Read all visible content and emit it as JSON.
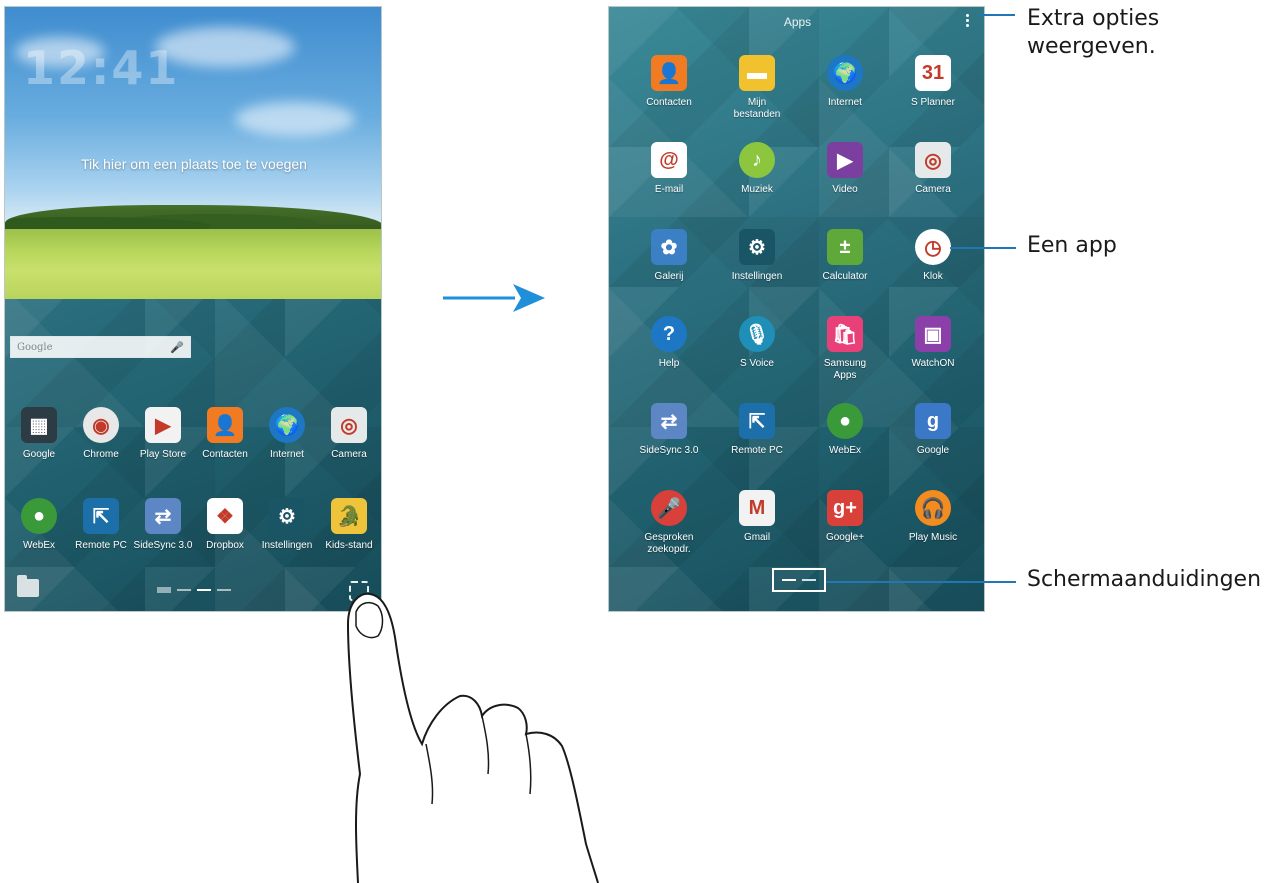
{
  "home": {
    "clock": "12:41",
    "clock_sub": "",
    "add_place": "Tik hier om een plaats toe te voegen",
    "search_label": "Google",
    "apps": [
      {
        "label": "Google",
        "icon": "google-folder-icon",
        "color": "#2d3b45"
      },
      {
        "label": "Chrome",
        "icon": "chrome-icon",
        "color": "#e8e8e8"
      },
      {
        "label": "Play Store",
        "icon": "play-store-icon",
        "color": "#f2f2f2"
      },
      {
        "label": "Contacten",
        "icon": "contacts-icon",
        "color": "#f07b22"
      },
      {
        "label": "Internet",
        "icon": "globe-icon",
        "color": "#1d77c4"
      },
      {
        "label": "Camera",
        "icon": "camera-icon",
        "color": "#e6e9ea"
      },
      {
        "label": "WebEx",
        "icon": "webex-icon",
        "color": "#3a9a3a"
      },
      {
        "label": "Remote PC",
        "icon": "remote-pc-icon",
        "color": "#1c6fa8"
      },
      {
        "label": "SideSync 3.0",
        "icon": "sidesync-icon",
        "color": "#5d86c5"
      },
      {
        "label": "Dropbox",
        "icon": "dropbox-icon",
        "color": "#ffffff"
      },
      {
        "label": "Instellingen",
        "icon": "settings-gear-icon",
        "color": "#1a5566"
      },
      {
        "label": "Kids-stand",
        "icon": "kids-mode-icon",
        "color": "#f0c43a"
      }
    ]
  },
  "apps_screen": {
    "title": "Apps",
    "apps": [
      {
        "label": "Contacten",
        "icon": "contacts-icon",
        "color": "#f07b22"
      },
      {
        "label": "Mijn bestanden",
        "icon": "folder-icon",
        "color": "#f2c12e"
      },
      {
        "label": "Internet",
        "icon": "globe-icon",
        "color": "#1d77c4"
      },
      {
        "label": "S Planner",
        "icon": "calendar-icon",
        "color": "#ffffff"
      },
      {
        "label": "E-mail",
        "icon": "email-icon",
        "color": "#ffffff"
      },
      {
        "label": "Muziek",
        "icon": "music-icon",
        "color": "#8cc63f"
      },
      {
        "label": "Video",
        "icon": "video-icon",
        "color": "#7b3fa0"
      },
      {
        "label": "Camera",
        "icon": "camera-icon",
        "color": "#e6e9ea"
      },
      {
        "label": "Galerij",
        "icon": "gallery-icon",
        "color": "#3b7fc4"
      },
      {
        "label": "Instellingen",
        "icon": "settings-gear-icon",
        "color": "#1a5566"
      },
      {
        "label": "Calculator",
        "icon": "calculator-icon",
        "color": "#5fa83a"
      },
      {
        "label": "Klok",
        "icon": "clock-icon",
        "color": "#ffffff"
      },
      {
        "label": "Help",
        "icon": "help-icon",
        "color": "#1d77c4"
      },
      {
        "label": "S Voice",
        "icon": "microphone-icon",
        "color": "#1f8fb8"
      },
      {
        "label": "Samsung Apps",
        "icon": "samsung-apps-icon",
        "color": "#e8417a"
      },
      {
        "label": "WatchON",
        "icon": "watchon-icon",
        "color": "#8b3fa8"
      },
      {
        "label": "SideSync 3.0",
        "icon": "sidesync-icon",
        "color": "#5d86c5"
      },
      {
        "label": "Remote PC",
        "icon": "remote-pc-icon",
        "color": "#1c6fa8"
      },
      {
        "label": "WebEx",
        "icon": "webex-icon",
        "color": "#3a9a3a"
      },
      {
        "label": "Google",
        "icon": "google-icon",
        "color": "#3b78c8"
      },
      {
        "label": "Gesproken zoekopdr.",
        "icon": "voice-search-icon",
        "color": "#d9403a"
      },
      {
        "label": "Gmail",
        "icon": "gmail-icon",
        "color": "#f2f2f2"
      },
      {
        "label": "Google+",
        "icon": "google-plus-icon",
        "color": "#d9403a"
      },
      {
        "label": "Play Music",
        "icon": "play-music-icon",
        "color": "#f28c1e"
      }
    ]
  },
  "callouts": {
    "extra_options": "Extra opties weergeven.",
    "an_app": "Een app",
    "page_indicators": "Schermaanduidingen"
  },
  "colors": {
    "callout_line": "#1f78b4",
    "arrow": "#1e8fd8"
  }
}
